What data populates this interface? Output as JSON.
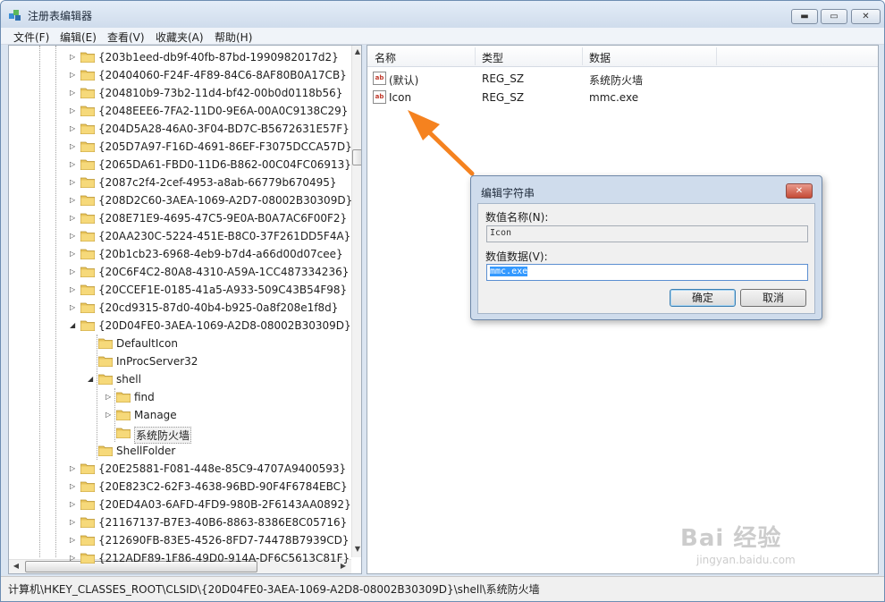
{
  "window": {
    "title": "注册表编辑器",
    "min_label": "▬",
    "max_label": "▭",
    "close_label": "✕"
  },
  "menu": [
    "文件(F)",
    "编辑(E)",
    "查看(V)",
    "收藏夹(A)",
    "帮助(H)"
  ],
  "tree": {
    "keys_before": [
      "{203b1eed-db9f-40fb-87bd-1990982017d2}",
      "{20404060-F24F-4F89-84C6-8AF80B0A17CB}",
      "{204810b9-73b2-11d4-bf42-00b0d0118b56}",
      "{2048EEE6-7FA2-11D0-9E6A-00A0C9138C29}",
      "{204D5A28-46A0-3F04-BD7C-B5672631E57F}",
      "{205D7A97-F16D-4691-86EF-F3075DCCA57D}",
      "{2065DA61-FBD0-11D6-B862-00C04FC06913}",
      "{2087c2f4-2cef-4953-a8ab-66779b670495}",
      "{208D2C60-3AEA-1069-A2D7-08002B30309D}",
      "{208E71E9-4695-47C5-9E0A-B0A7AC6F00F2}",
      "{20AA230C-5224-451E-B8C0-37F261DD5F4A}",
      "{20b1cb23-6968-4eb9-b7d4-a66d00d07cee}",
      "{20C6F4C2-80A8-4310-A59A-1CC487334236}",
      "{20CCEF1E-0185-41a5-A933-509C43B54F98}",
      "{20cd9315-87d0-40b4-b925-0a8f208e1f8d}"
    ],
    "expanded_key": "{20D04FE0-3AEA-1069-A2D8-08002B30309D}",
    "children": {
      "default_icon": "DefaultIcon",
      "inproc": "InProcServer32",
      "shell": "shell",
      "find": "find",
      "manage": "Manage",
      "firewall": "系统防火墙",
      "shellfolder": "ShellFolder"
    },
    "keys_after": [
      "{20E25881-F081-448e-85C9-4707A9400593}",
      "{20E823C2-62F3-4638-96BD-90F4F6784EBC}",
      "{20ED4A03-6AFD-4FD9-980B-2F6143AA0892}",
      "{21167137-B7E3-40B6-8863-8386E8C05716}",
      "{212690FB-83E5-4526-8FD7-74478B7939CD}",
      "{212ADF89-1F86-49D0-914A-DF6C5613C81F}"
    ]
  },
  "list": {
    "headers": {
      "name": "名称",
      "type": "类型",
      "data": "数据"
    },
    "rows": [
      {
        "name": "(默认)",
        "type": "REG_SZ",
        "data": "系统防火墙"
      },
      {
        "name": "Icon",
        "type": "REG_SZ",
        "data": "mmc.exe"
      }
    ],
    "icon_text": "ab"
  },
  "status": "计算机\\HKEY_CLASSES_ROOT\\CLSID\\{20D04FE0-3AEA-1069-A2D8-08002B30309D}\\shell\\系统防火墙",
  "dialog": {
    "title": "编辑字符串",
    "name_label": "数值名称(N):",
    "name_value": "Icon",
    "data_label": "数值数据(V):",
    "data_value": "mmc.exe",
    "ok": "确定",
    "cancel": "取消"
  },
  "watermark": {
    "logo": "Bai 经验",
    "sub": "jingyan.baidu.com"
  },
  "colors": {
    "arrow": "#f5821f",
    "folder": "#e8c45c",
    "selection": "#3399ff"
  }
}
